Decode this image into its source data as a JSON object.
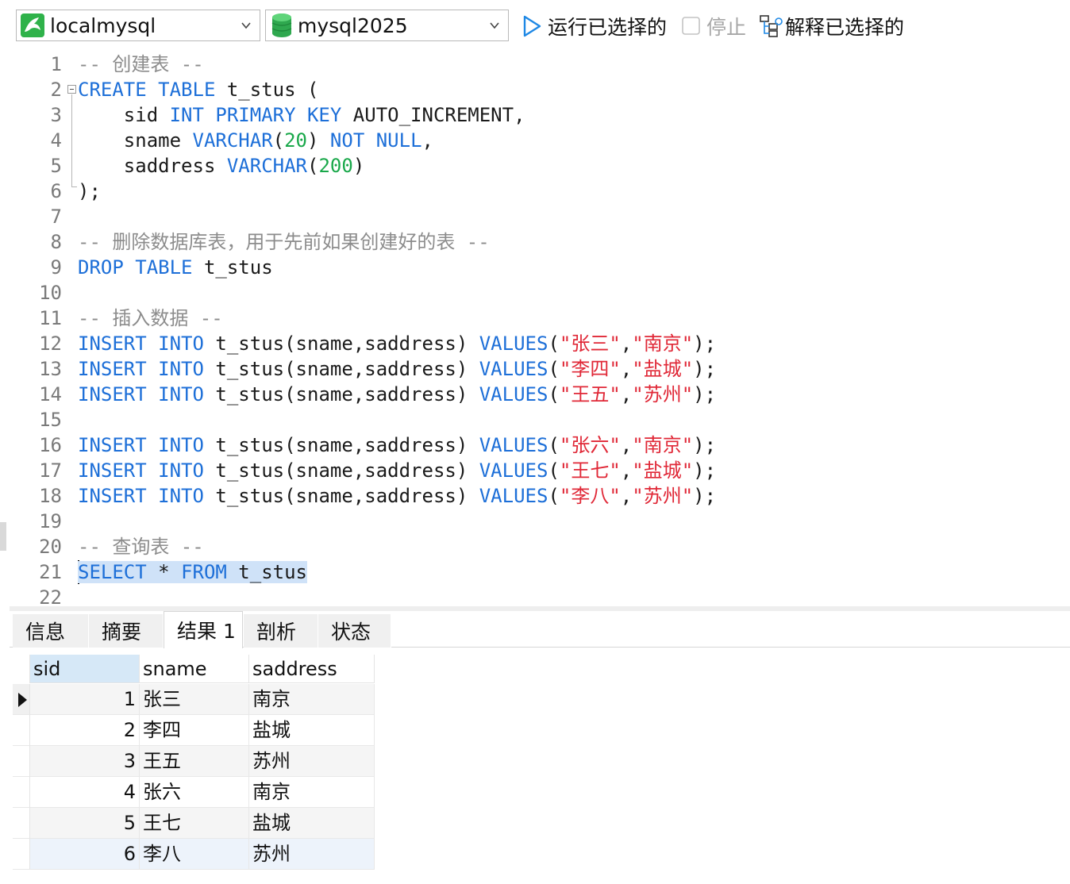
{
  "toolbar": {
    "connection": "localmysql",
    "database": "mysql2025",
    "run_label": "运行已选择的",
    "stop_label": "停止",
    "explain_label": "解释已选择的",
    "colors": {
      "run_icon": "#1e88e5",
      "db_icon": "#2fa84f",
      "conn_icon": "#2fb24a"
    }
  },
  "editor": {
    "lines": [
      {
        "n": "1",
        "tokens": [
          [
            "cmt",
            "-- 创建表 --"
          ]
        ]
      },
      {
        "n": "2",
        "tokens": [
          [
            "kw",
            "CREATE TABLE"
          ],
          [
            "",
            " t_stus ("
          ]
        ]
      },
      {
        "n": "3",
        "tokens": [
          [
            "",
            "    sid "
          ],
          [
            "kw",
            "INT PRIMARY KEY"
          ],
          [
            "",
            " AUTO_INCREMENT,"
          ]
        ]
      },
      {
        "n": "4",
        "tokens": [
          [
            "",
            "    sname "
          ],
          [
            "kw",
            "VARCHAR"
          ],
          [
            "",
            "("
          ],
          [
            "num",
            "20"
          ],
          [
            "",
            ") "
          ],
          [
            "kw",
            "NOT NULL"
          ],
          [
            "",
            ","
          ]
        ]
      },
      {
        "n": "5",
        "tokens": [
          [
            "",
            "    saddress "
          ],
          [
            "kw",
            "VARCHAR"
          ],
          [
            "",
            "("
          ],
          [
            "num",
            "200"
          ],
          [
            "",
            ")"
          ]
        ]
      },
      {
        "n": "6",
        "tokens": [
          [
            "",
            ");"
          ]
        ]
      },
      {
        "n": "7",
        "tokens": []
      },
      {
        "n": "8",
        "tokens": [
          [
            "cmt",
            "-- 删除数据库表，用于先前如果创建好的表 --"
          ]
        ]
      },
      {
        "n": "9",
        "tokens": [
          [
            "kw",
            "DROP TABLE"
          ],
          [
            "",
            " t_stus"
          ]
        ]
      },
      {
        "n": "10",
        "tokens": []
      },
      {
        "n": "11",
        "tokens": [
          [
            "cmt",
            "-- 插入数据 --"
          ]
        ]
      },
      {
        "n": "12",
        "tokens": [
          [
            "kw",
            "INSERT INTO"
          ],
          [
            "",
            " t_stus(sname,saddress) "
          ],
          [
            "kw",
            "VALUES"
          ],
          [
            "",
            "("
          ],
          [
            "str",
            "\"张三\""
          ],
          [
            "",
            ","
          ],
          [
            "str",
            "\"南京\""
          ],
          [
            "",
            ");"
          ]
        ]
      },
      {
        "n": "13",
        "tokens": [
          [
            "kw",
            "INSERT INTO"
          ],
          [
            "",
            " t_stus(sname,saddress) "
          ],
          [
            "kw",
            "VALUES"
          ],
          [
            "",
            "("
          ],
          [
            "str",
            "\"李四\""
          ],
          [
            "",
            ","
          ],
          [
            "str",
            "\"盐城\""
          ],
          [
            "",
            ");"
          ]
        ]
      },
      {
        "n": "14",
        "tokens": [
          [
            "kw",
            "INSERT INTO"
          ],
          [
            "",
            " t_stus(sname,saddress) "
          ],
          [
            "kw",
            "VALUES"
          ],
          [
            "",
            "("
          ],
          [
            "str",
            "\"王五\""
          ],
          [
            "",
            ","
          ],
          [
            "str",
            "\"苏州\""
          ],
          [
            "",
            ");"
          ]
        ]
      },
      {
        "n": "15",
        "tokens": []
      },
      {
        "n": "16",
        "tokens": [
          [
            "kw",
            "INSERT INTO"
          ],
          [
            "",
            " t_stus(sname,saddress) "
          ],
          [
            "kw",
            "VALUES"
          ],
          [
            "",
            "("
          ],
          [
            "str",
            "\"张六\""
          ],
          [
            "",
            ","
          ],
          [
            "str",
            "\"南京\""
          ],
          [
            "",
            ");"
          ]
        ]
      },
      {
        "n": "17",
        "tokens": [
          [
            "kw",
            "INSERT INTO"
          ],
          [
            "",
            " t_stus(sname,saddress) "
          ],
          [
            "kw",
            "VALUES"
          ],
          [
            "",
            "("
          ],
          [
            "str",
            "\"王七\""
          ],
          [
            "",
            ","
          ],
          [
            "str",
            "\"盐城\""
          ],
          [
            "",
            ");"
          ]
        ]
      },
      {
        "n": "18",
        "tokens": [
          [
            "kw",
            "INSERT INTO"
          ],
          [
            "",
            " t_stus(sname,saddress) "
          ],
          [
            "kw",
            "VALUES"
          ],
          [
            "",
            "("
          ],
          [
            "str",
            "\"李八\""
          ],
          [
            "",
            ","
          ],
          [
            "str",
            "\"苏州\""
          ],
          [
            "",
            ");"
          ]
        ]
      },
      {
        "n": "19",
        "tokens": []
      },
      {
        "n": "20",
        "tokens": [
          [
            "cmt",
            "-- 查询表 --"
          ]
        ]
      },
      {
        "n": "21",
        "tokens": [
          [
            "kw sel",
            "SELECT"
          ],
          [
            "sel",
            " * "
          ],
          [
            "kw sel",
            "FROM"
          ],
          [
            "sel",
            " t_stus"
          ]
        ]
      },
      {
        "n": "22",
        "tokens": []
      }
    ]
  },
  "result_tabs": [
    {
      "label": "信息",
      "name": "tab-info"
    },
    {
      "label": "摘要",
      "name": "tab-summary"
    },
    {
      "label": "结果 1",
      "name": "tab-result-1",
      "active": true
    },
    {
      "label": "剖析",
      "name": "tab-profile"
    },
    {
      "label": "状态",
      "name": "tab-status"
    }
  ],
  "grid": {
    "columns": [
      "sid",
      "sname",
      "saddress"
    ],
    "rows": [
      [
        "1",
        "张三",
        "南京"
      ],
      [
        "2",
        "李四",
        "盐城"
      ],
      [
        "3",
        "王五",
        "苏州"
      ],
      [
        "4",
        "张六",
        "南京"
      ],
      [
        "5",
        "王七",
        "盐城"
      ],
      [
        "6",
        "李八",
        "苏州"
      ]
    ]
  }
}
